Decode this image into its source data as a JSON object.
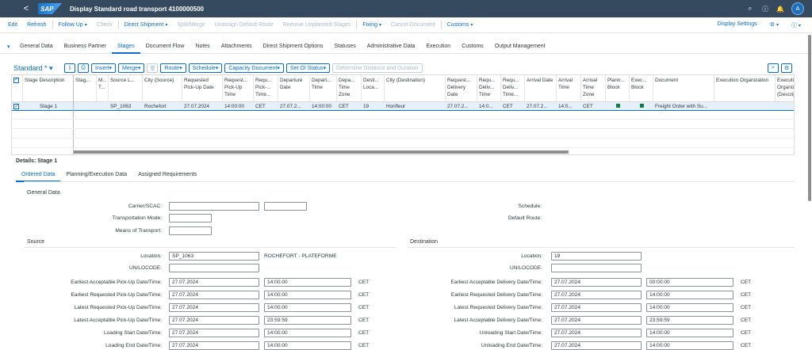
{
  "shell": {
    "back": "<",
    "logo": "SAP",
    "title": "Display Standard road transport 4100000500",
    "avatar": "A"
  },
  "toolbar": {
    "items": [
      {
        "label": "Edit",
        "enabled": true,
        "dd": false
      },
      {
        "label": "Refresh",
        "enabled": true,
        "dd": false
      },
      {
        "label": "Follow Up",
        "enabled": true,
        "dd": true
      },
      {
        "label": "Check",
        "enabled": false,
        "dd": false
      },
      {
        "label": "Direct Shipment",
        "enabled": true,
        "dd": true
      },
      {
        "label": "Split/Merge",
        "enabled": false,
        "dd": false
      },
      {
        "label": "Unassign Default Route",
        "enabled": false,
        "dd": false
      },
      {
        "label": "Remove Unplanned Stages",
        "enabled": false,
        "dd": false
      },
      {
        "label": "Fixing",
        "enabled": true,
        "dd": true
      },
      {
        "label": "Cancel Document",
        "enabled": false,
        "dd": false
      },
      {
        "label": "Customs",
        "enabled": true,
        "dd": true
      }
    ],
    "display_settings": "Display Settings"
  },
  "tabs": [
    "General Data",
    "Business Partner",
    "Stages",
    "Document Flow",
    "Notes",
    "Attachments",
    "Direct Shipment Options",
    "Statuses",
    "Administrative Data",
    "Execution",
    "Customs",
    "Output Management"
  ],
  "active_tab": "Stages",
  "stages": {
    "variant": "Standard *",
    "buttons": [
      {
        "label": "Insert",
        "dd": true
      },
      {
        "label": "Merge",
        "dd": true
      },
      {
        "label": "Route",
        "dd": true
      },
      {
        "label": "Schedule",
        "dd": true
      },
      {
        "label": "Capacity Document",
        "dd": true
      },
      {
        "label": "Set OI Status",
        "dd": true
      },
      {
        "label": "Determine Distance and Duration",
        "dd": false
      }
    ],
    "columns": [
      "Stage Description",
      "Stag...",
      "M... T...",
      "Source L...",
      "City (Source)",
      "Requested Pick-Up Date",
      "Request... Pick-Up Time",
      "Requ... Pick-... Time...",
      "Departure Date",
      "Depart... Time",
      "Depa... Time Zone",
      "Desti... Loca...",
      "City (Destination)",
      "Request... Delivery Date",
      "Requ... Deliv... Time",
      "Requ... Deliv... Time...",
      "Arrival Date",
      "Arrival Time",
      "Arrival Time Zone",
      "Plann... Block",
      "Exec... Block",
      "Document",
      "Execution Organization",
      "Executi... Organiz... (Descrip..."
    ],
    "row": [
      "Stage 1",
      "",
      "",
      "SP_1063",
      "Rochefort",
      "27.07.2024",
      "14:00:00",
      "CET",
      "27.07.2...",
      "14:00:00",
      "CET",
      "19",
      "Honfleur",
      "27.07.2...",
      "14:0...",
      "CET",
      "27.07.2...",
      "14:0...",
      "CET",
      "",
      "",
      "Freight Order with Su...",
      "",
      ""
    ]
  },
  "details": {
    "title": "Details: Stage 1",
    "tabs": [
      "Ordered Data",
      "Planning/Execution Data",
      "Assigned Requirements"
    ],
    "general_data": "General Data",
    "carrier_label": "Carrier/SCAC:",
    "transport_mode_label": "Transportation Mode:",
    "means_label": "Means of Transport:",
    "schedule_label": "Schedule:",
    "default_route_label": "Default Route:",
    "source": {
      "heading": "Source",
      "location_label": "Location:",
      "location": "SP_1063",
      "location_desc": "ROCHEFORT - PLATEFORME",
      "unlocode_label": "UN/LOCODE:",
      "rows": [
        {
          "label": "Earliest Acceptable Pick-Up Date/Time:",
          "date": "27.07.2024",
          "time": "14:00:00",
          "tz": "CET"
        },
        {
          "label": "Earliest Requested Pick-Up Date/Time:",
          "date": "27.07.2024",
          "time": "14:00:00",
          "tz": "CET"
        },
        {
          "label": "Latest Requested Pick-Up Date/Time:",
          "date": "27.07.2024",
          "time": "14:00:00",
          "tz": "CET"
        },
        {
          "label": "Latest Acceptable Pick-Up Date/Time:",
          "date": "27.07.2024",
          "time": "23:59:59",
          "tz": "CET"
        },
        {
          "label": "Loading Start Date/Time:",
          "date": "27.07.2024",
          "time": "14:00:00",
          "tz": "CET"
        },
        {
          "label": "Loading End Date/Time:",
          "date": "27.07.2024",
          "time": "14:00:00",
          "tz": "CET"
        }
      ]
    },
    "destination": {
      "heading": "Destination",
      "location_label": "Location:",
      "location": "19",
      "unlocode_label": "UN/LOCODE:",
      "rows": [
        {
          "label": "Earliest Acceptable Delivery Date/Time:",
          "date": "27.07.2024",
          "time": "00:00:00",
          "tz": "CET"
        },
        {
          "label": "Earliest Requested Delivery Date/Time:",
          "date": "27.07.2024",
          "time": "14:00:00",
          "tz": "CET"
        },
        {
          "label": "Latest Requested Delivery Date/Time:",
          "date": "27.07.2024",
          "time": "14:00:00",
          "tz": "CET"
        },
        {
          "label": "Latest Acceptable Delivery Date/Time:",
          "date": "27.07.2024",
          "time": "23:59:59",
          "tz": "CET"
        },
        {
          "label": "Unloading Start Date/Time:",
          "date": "27.07.2024",
          "time": "14:00:00",
          "tz": "CET"
        },
        {
          "label": "Unloading End Date/Time:",
          "date": "27.07.2024",
          "time": "14:00:00",
          "tz": "CET"
        }
      ]
    }
  }
}
